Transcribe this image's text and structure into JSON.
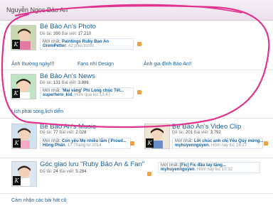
{
  "header": {
    "title": "Nguyễn Ngọc Bảo An"
  },
  "labels": {
    "topics": "Đề tài:",
    "posts": "Bài viết:",
    "latest": "Mới nhất:"
  },
  "forums": [
    {
      "name": "Bé Bảo An's Photo",
      "topics": "390",
      "posts": "17.210",
      "latest_title": "Paintings Ruby Bao An",
      "latest_user": "GremPetter",
      "latest_time": "42 phút trước"
    },
    {
      "name": "Bé Bảo An's News",
      "topics": "131",
      "posts": "3.886",
      "latest_title": "'Mai vàng' Phi Long chúc Tết...",
      "latest_user": "superhero_kid",
      "latest_time": "Hôm qua lúc 13:47"
    },
    {
      "name": "Bé Bảo An's Music",
      "topics": "77",
      "posts": "2.028",
      "latest_title": "Con yêu Mẹ nhiều lắm ( Proud...",
      "latest_user": "Hồng Phấn",
      "latest_time": "17 Tháng tư 2014"
    },
    {
      "name": "Bé Bảo An's Video Clip",
      "topics": "201",
      "posts": "3.792",
      "latest_title": "Lời chúc anh chị Yêu Quý mừng...",
      "latest_user": "myhuyennguyen",
      "latest_time": "Hôm nay lúc 16:27"
    },
    {
      "name": "Góc giao lưu \"Ruby Bảo An & Fan\"",
      "topics": "24",
      "posts": "5.284",
      "latest_title": "[Fic] Fic đầu tay tặng...",
      "latest_user": "myhuyennguyen",
      "latest_time": "Hôm nay lúc 10:32"
    }
  ],
  "subforums": {
    "photo": [
      "Ảnh thường ngày!!!",
      "Fans nhí Design",
      "Ảnh gia đình Bảo An!!"
    ],
    "news": [
      "Lịch phát sóng,lịch diễn"
    ]
  },
  "bottom_link": "Cảm nhận các bài hát cũ"
}
